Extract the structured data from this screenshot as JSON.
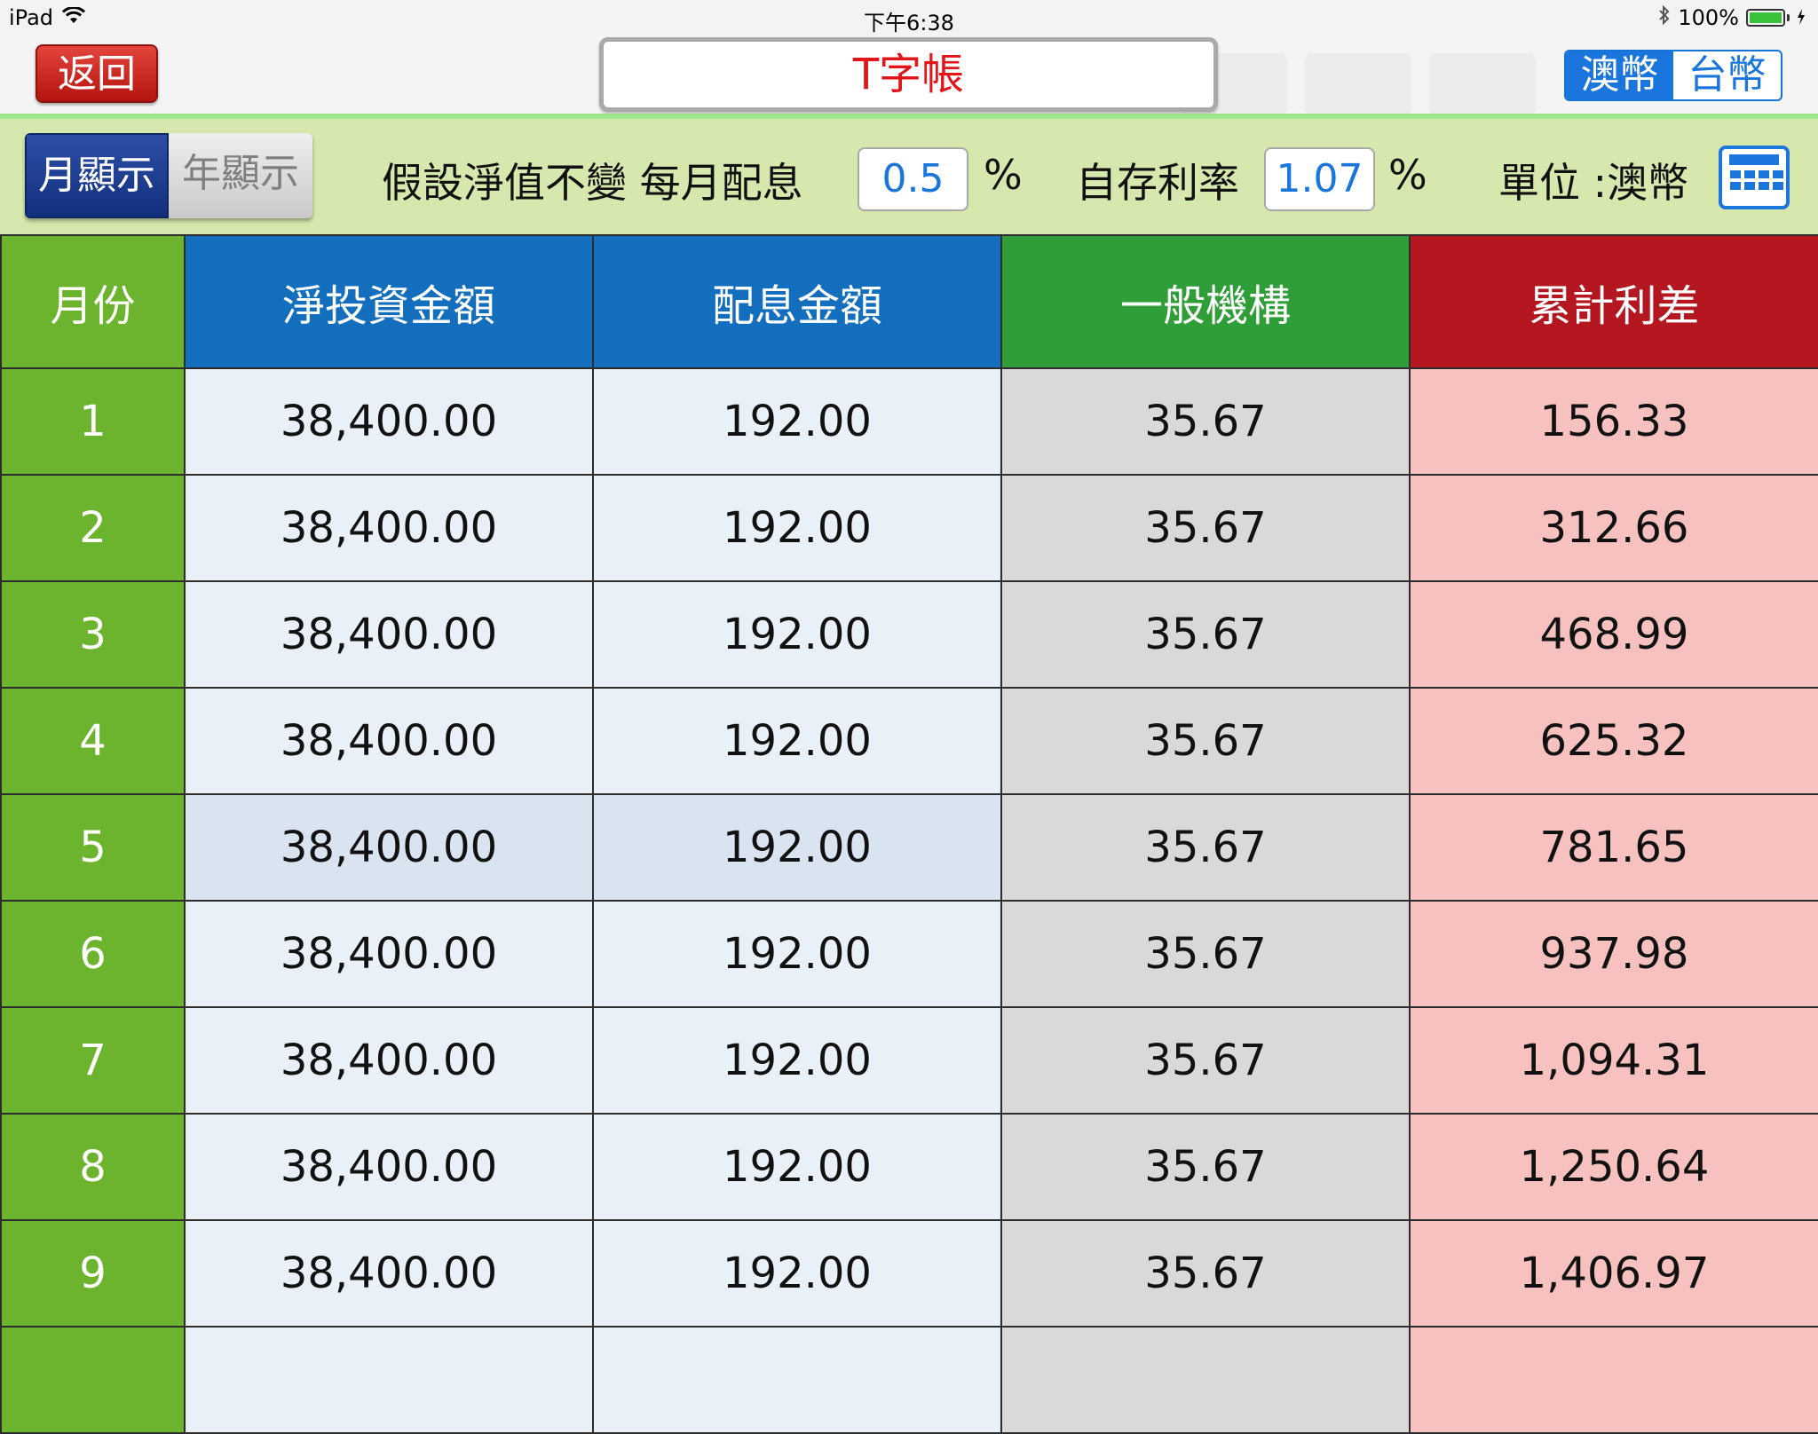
{
  "status_bar": {
    "device": "iPad",
    "time": "下午6:38",
    "battery": "100%",
    "battery_level": 1.0
  },
  "nav": {
    "back_label": "返回",
    "title": "T字帳",
    "currency_options": [
      "澳幣",
      "台幣"
    ],
    "currency_selected": "澳幣"
  },
  "settings": {
    "view_options": [
      "月顯示",
      "年顯示"
    ],
    "view_selected": "月顯示",
    "dividend_label": "假設淨值不變 每月配息",
    "dividend_value": "0.5",
    "dividend_unit": "%",
    "rate_label": "自存利率",
    "rate_value": "1.07",
    "rate_unit": "%",
    "unit_label": "單位 :澳幣"
  },
  "table": {
    "headers": [
      "月份",
      "淨投資金額",
      "配息金額",
      "一般機構",
      "累計利差"
    ],
    "rows": [
      [
        "1",
        "38,400.00",
        "192.00",
        "35.67",
        "156.33"
      ],
      [
        "2",
        "38,400.00",
        "192.00",
        "35.67",
        "312.66"
      ],
      [
        "3",
        "38,400.00",
        "192.00",
        "35.67",
        "468.99"
      ],
      [
        "4",
        "38,400.00",
        "192.00",
        "35.67",
        "625.32"
      ],
      [
        "5",
        "38,400.00",
        "192.00",
        "35.67",
        "781.65"
      ],
      [
        "6",
        "38,400.00",
        "192.00",
        "35.67",
        "937.98"
      ],
      [
        "7",
        "38,400.00",
        "192.00",
        "35.67",
        "1,094.31"
      ],
      [
        "8",
        "38,400.00",
        "192.00",
        "35.67",
        "1,250.64"
      ],
      [
        "9",
        "38,400.00",
        "192.00",
        "35.67",
        "1,406.97"
      ],
      [
        "",
        "",
        "",
        "",
        ""
      ]
    ],
    "highlighted_row": "5"
  }
}
